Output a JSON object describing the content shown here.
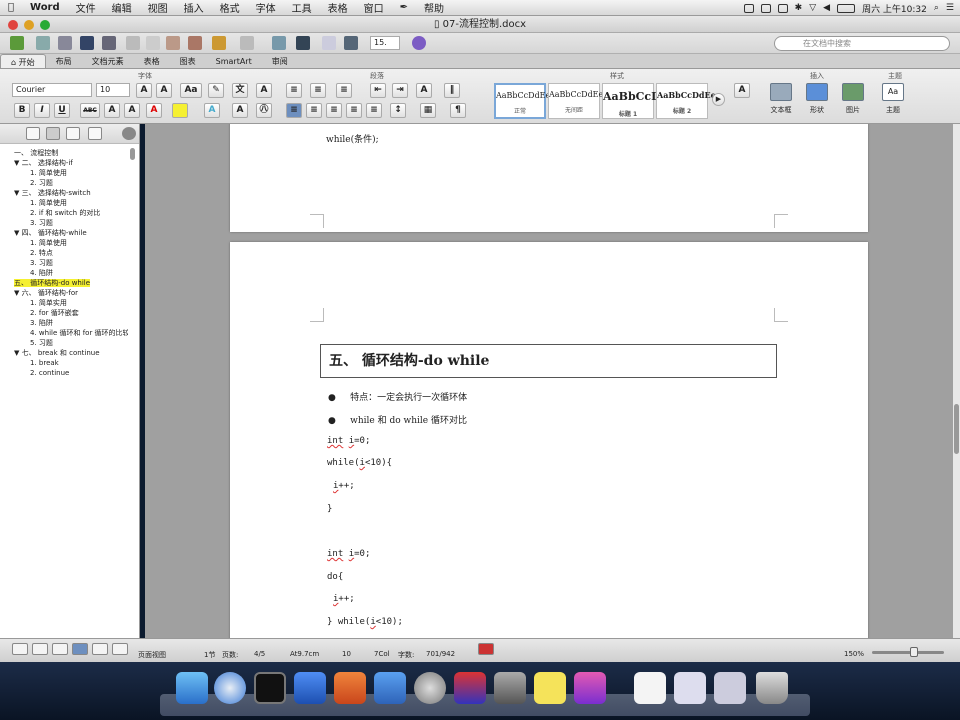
{
  "menubar": {
    "apple": "",
    "app": "Word",
    "items": [
      "文件",
      "编辑",
      "视图",
      "插入",
      "格式",
      "字体",
      "工具",
      "表格",
      "窗口",
      "帮助"
    ],
    "clock": "周六 上午10:32"
  },
  "window": {
    "title": "07-流程控制.docx"
  },
  "toolbar": {
    "zoom": "15.",
    "search_placeholder": "在文档中搜索"
  },
  "tabs": [
    "开始",
    "布局",
    "文档元素",
    "表格",
    "图表",
    "SmartArt",
    "审阅"
  ],
  "ribbon": {
    "groups": {
      "font": "字体",
      "paragraph": "段落",
      "styles": "样式",
      "insert": "插入",
      "theme": "主题"
    },
    "font_name": "Courier",
    "font_size": "10",
    "styles": [
      {
        "sample": "AaBbCcDdEe",
        "caption": "正常"
      },
      {
        "sample": "AaBbCcDdEe",
        "caption": "无间距"
      },
      {
        "sample": "AaBbCcD",
        "caption": "标题 1"
      },
      {
        "sample": "AaBbCcDdEe",
        "caption": "标题 2"
      }
    ],
    "insert_buttons": [
      {
        "label": "文本框"
      },
      {
        "label": "形状"
      },
      {
        "label": "图片"
      }
    ],
    "theme_label": "主题",
    "theme_sample": "Aa"
  },
  "nav": [
    {
      "text": "一、 流程控制",
      "level": 0
    },
    {
      "text": "▼ 二、 选择结构-if",
      "level": 0
    },
    {
      "text": "1. 简单使用",
      "level": 1
    },
    {
      "text": "2. 习题",
      "level": 1
    },
    {
      "text": "▼ 三、 选择结构-switch",
      "level": 0
    },
    {
      "text": "1. 简单使用",
      "level": 1
    },
    {
      "text": "2. if 和 switch 的对比",
      "level": 1
    },
    {
      "text": "3. 习题",
      "level": 1
    },
    {
      "text": "▼ 四、 循环结构-while",
      "level": 0
    },
    {
      "text": "1. 简单使用",
      "level": 1
    },
    {
      "text": "2. 特点",
      "level": 1
    },
    {
      "text": "3. 习题",
      "level": 1
    },
    {
      "text": "4. 陷阱",
      "level": 1
    },
    {
      "text": "五、 循环结构-do while",
      "level": 0,
      "highlight": true
    },
    {
      "text": "▼ 六、 循环结构-for",
      "level": 0
    },
    {
      "text": "1. 简单实用",
      "level": 1
    },
    {
      "text": "2. for 循环嵌套",
      "level": 1
    },
    {
      "text": "3. 陷阱",
      "level": 1
    },
    {
      "text": "4. while 循环和 for 循环的比较",
      "level": 1
    },
    {
      "text": "5. 习题",
      "level": 1
    },
    {
      "text": "▼ 七、 break 和 continue",
      "level": 0
    },
    {
      "text": "1. break",
      "level": 1
    },
    {
      "text": "2. continue",
      "level": 1
    }
  ],
  "document": {
    "page1_line": "while(条件);",
    "heading": "五、 循环结构-do while",
    "bullets": [
      "特点：一定会执行一次循环体",
      "while 和 do while 循环对比"
    ],
    "code1": {
      "l1a": "int",
      "l1b": "i",
      "l1c": "=0;",
      "l2a": "while(",
      "l2b": "i",
      "l2c": "<10){",
      "l3a": "i",
      "l3b": "++;",
      "l4": "}"
    },
    "code2": {
      "l1a": "int",
      "l1b": "i",
      "l1c": "=0;",
      "l2": "do{",
      "l3a": "i",
      "l3b": "++;",
      "l4a": "} while(",
      "l4b": "i",
      "l4c": "<10);"
    }
  },
  "status": {
    "view": "页面视图",
    "section_label": "1节",
    "pages_label": "页数:",
    "pages": "4/5",
    "at": "At9.7cm",
    "line": "10",
    "col": "7Col",
    "words_label": "字数:",
    "words": "701/942",
    "zoom": "150%"
  }
}
